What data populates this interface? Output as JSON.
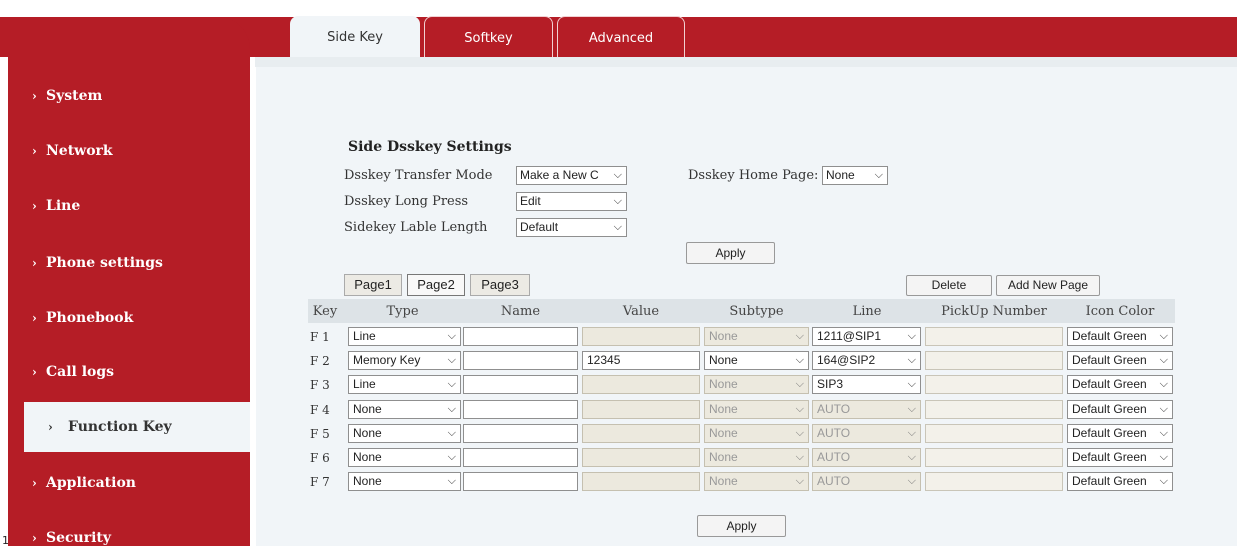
{
  "sidebar": {
    "items": [
      {
        "label": "System"
      },
      {
        "label": "Network"
      },
      {
        "label": "Line"
      },
      {
        "label": "Phone settings"
      },
      {
        "label": "Phonebook"
      },
      {
        "label": "Call logs"
      },
      {
        "label": "Function Key"
      },
      {
        "label": "Application"
      },
      {
        "label": "Security"
      }
    ],
    "chevron": "›",
    "active": "Function Key"
  },
  "edge_number": "1",
  "tabs": [
    {
      "label": "Side Key"
    },
    {
      "label": "Softkey"
    },
    {
      "label": "Advanced"
    }
  ],
  "settings": {
    "title": "Side Dsskey Settings",
    "transfer_mode_label": "Dsskey Transfer Mode",
    "transfer_mode_value": "Make a New C",
    "home_page_label": "Dsskey Home Page:",
    "home_page_value": "None",
    "long_press_label": "Dsskey Long Press",
    "long_press_value": "Edit",
    "label_length_label": "Sidekey Lable Length",
    "label_length_value": "Default",
    "apply": "Apply"
  },
  "pages": {
    "buttons": [
      "Page1",
      "Page2",
      "Page3"
    ],
    "delete": "Delete",
    "add_new": "Add New Page"
  },
  "table": {
    "headers": [
      "Key",
      "Type",
      "Name",
      "Value",
      "Subtype",
      "Line",
      "PickUp Number",
      "Icon Color"
    ],
    "rows": [
      {
        "key": "F 1",
        "type": "Line",
        "name": "",
        "value": "",
        "subtype": "None",
        "line": "1211@SIP1",
        "pickup": "",
        "color": "Default Green"
      },
      {
        "key": "F 2",
        "type": "Memory Key",
        "name": "",
        "value": "12345",
        "subtype": "None",
        "line": "164@SIP2",
        "pickup": "",
        "color": "Default Green"
      },
      {
        "key": "F 3",
        "type": "Line",
        "name": "",
        "value": "",
        "subtype": "None",
        "line": "SIP3",
        "pickup": "",
        "color": "Default Green"
      },
      {
        "key": "F 4",
        "type": "None",
        "name": "",
        "value": "",
        "subtype": "None",
        "line": "AUTO",
        "pickup": "",
        "color": "Default Green"
      },
      {
        "key": "F 5",
        "type": "None",
        "name": "",
        "value": "",
        "subtype": "None",
        "line": "AUTO",
        "pickup": "",
        "color": "Default Green"
      },
      {
        "key": "F 6",
        "type": "None",
        "name": "",
        "value": "",
        "subtype": "None",
        "line": "AUTO",
        "pickup": "",
        "color": "Default Green"
      },
      {
        "key": "F 7",
        "type": "None",
        "name": "",
        "value": "",
        "subtype": "None",
        "line": "AUTO",
        "pickup": "",
        "color": "Default Green"
      }
    ]
  },
  "bottom_apply": "Apply",
  "colors": {
    "brand": "#b51d26",
    "panel": "#f1f5f8",
    "disabled": "#ece9de"
  }
}
